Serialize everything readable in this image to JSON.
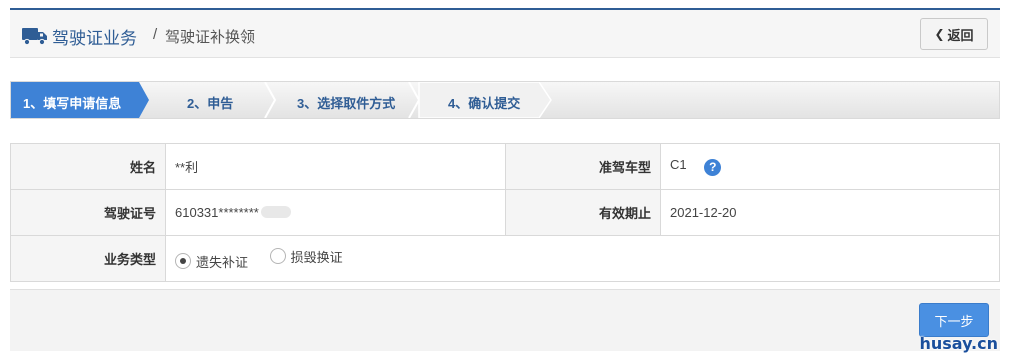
{
  "header": {
    "breadcrumb_main": "驾驶证业务",
    "breadcrumb_separator": "/",
    "breadcrumb_sub": "驾驶证补换领",
    "back_label": "返回",
    "icon": "truck-icon"
  },
  "steps": [
    {
      "label": "1、填写申请信息",
      "active": true
    },
    {
      "label": "2、申告",
      "active": false
    },
    {
      "label": "3、选择取件方式",
      "active": false
    },
    {
      "label": "4、确认提交",
      "active": false
    }
  ],
  "form": {
    "name_label": "姓名",
    "name_value": "**利",
    "vehicle_class_label": "准驾车型",
    "vehicle_class_value": "C1",
    "license_no_label": "驾驶证号",
    "license_no_value": "610331********",
    "expiry_label": "有效期止",
    "expiry_value": "2021-12-20",
    "business_type_label": "业务类型",
    "business_type_options": [
      {
        "label": "遗失补证",
        "selected": true
      },
      {
        "label": "损毁换证",
        "selected": false
      }
    ]
  },
  "footer": {
    "next_label": "下一步"
  },
  "watermark": "husay.cn",
  "colors": {
    "primary_blue": "#2f5d95",
    "active_step": "#3e82d6",
    "button_blue": "#4a90e2"
  }
}
